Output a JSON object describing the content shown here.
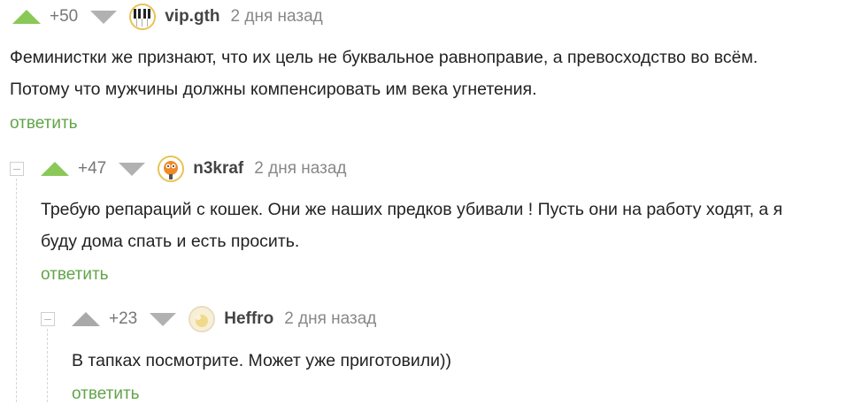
{
  "comments": [
    {
      "score": "+50",
      "username": "vip.gth",
      "time": "2 дня назад",
      "text_lines": [
        "Феминистки же признают, что их цель не буквальное равноправие, а превосходство во всём.",
        "Потому что мужчины должны компенсировать им века угнетения."
      ],
      "reply_label": "ответить",
      "avatar_icon": "piano-keys-avatar"
    },
    {
      "score": "+47",
      "username": "n3kraf",
      "time": "2 дня назад",
      "text_lines": [
        "Требую репараций с кошек. Они же наших предков убивали ! Пусть они на работу ходят, а я",
        "буду дома спать и есть просить."
      ],
      "reply_label": "ответить",
      "avatar_icon": "cartoon-character-avatar"
    },
    {
      "score": "+23",
      "username": "Heffro",
      "time": "2 дня назад",
      "text_lines": [
        "В тапках посмотрите. Может уже приготовили))"
      ],
      "reply_label": "ответить",
      "avatar_icon": "pale-yellow-avatar"
    }
  ],
  "colors": {
    "upvote_active": "#8ac858",
    "upvote_inactive": "#a9a9a9",
    "reply_link": "#62a449",
    "avatar_border": "#e9c24f"
  }
}
